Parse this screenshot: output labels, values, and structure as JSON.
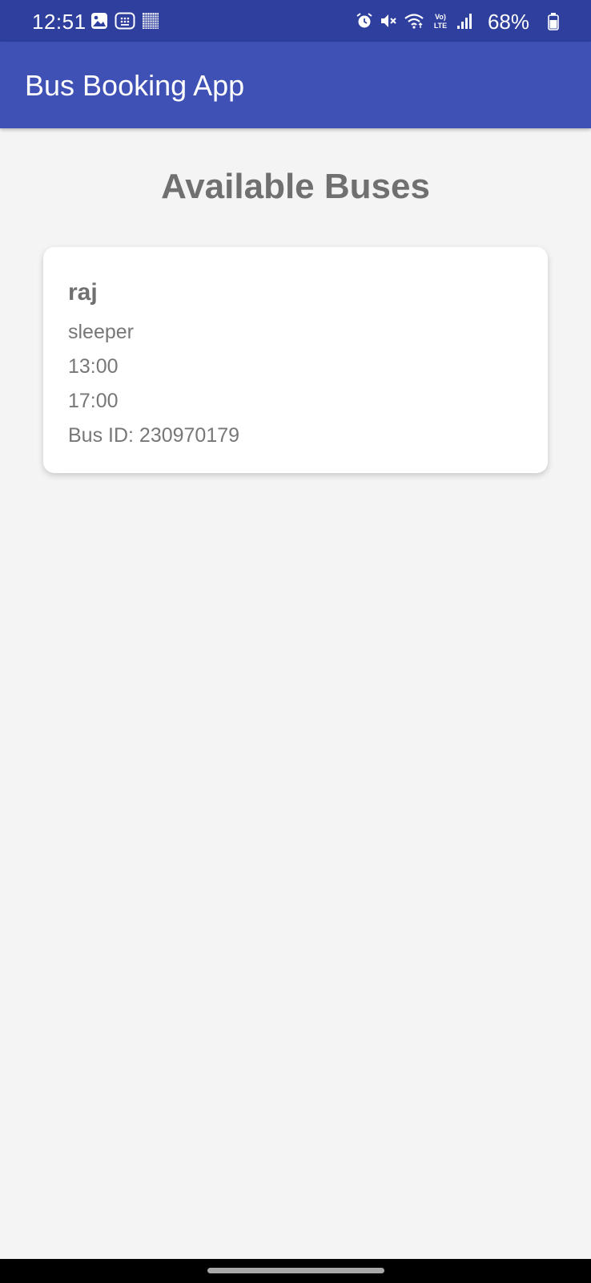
{
  "status_bar": {
    "time": "12:51",
    "battery": "68%",
    "left_icons": [
      "gallery-icon",
      "app-grid-icon",
      "qr-pattern-icon"
    ],
    "right_icons": [
      "alarm-icon",
      "mute-icon",
      "wifi-icon",
      "volte-lte-icon",
      "signal-icon"
    ],
    "battery_icon": "battery-icon"
  },
  "app_bar": {
    "title": "Bus Booking App",
    "color": "#3f51b5"
  },
  "page": {
    "heading": "Available Buses"
  },
  "buses": [
    {
      "name": "raj",
      "type": "sleeper",
      "departure": "13:00",
      "arrival": "17:00",
      "bus_id": "Bus ID: 230970179"
    }
  ],
  "colors": {
    "status_bar": "#2f3f9e",
    "background": "#f4f4f4",
    "text_muted": "#707070"
  }
}
